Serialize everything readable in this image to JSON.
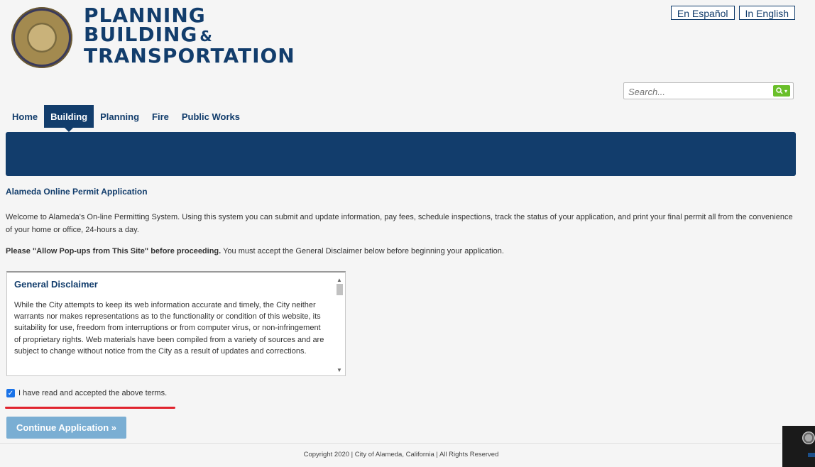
{
  "header": {
    "logo_line1": "Planning",
    "logo_line2": "Building",
    "logo_amp": "&",
    "logo_line3": "Transportation",
    "lang_spanish": "En Español",
    "lang_english": "In English"
  },
  "search": {
    "placeholder": "Search..."
  },
  "nav": {
    "items": [
      "Home",
      "Building",
      "Planning",
      "Fire",
      "Public Works"
    ],
    "active": "Building"
  },
  "main": {
    "title": "Alameda Online Permit Application",
    "welcome": "Welcome to Alameda's On-line Permitting System. Using this system you can submit and update information, pay fees, schedule inspections, track the status of your application, and print your final permit all from the convenience of your home or office, 24-hours a day.",
    "popup_bold": "Please \"Allow Pop-ups from This Site\" before proceeding.",
    "popup_rest": " You must accept the General Disclaimer below before beginning your application."
  },
  "disclaimer": {
    "title": "General Disclaimer",
    "text": "While the City attempts to keep its web information accurate and timely, the City neither warrants nor makes representations as to the functionality or condition of this website, its suitability for use, freedom from interruptions or from computer virus, or non-infringement of proprietary rights. Web materials have been compiled from a variety of sources and are subject to change without notice from the City as a result of updates and corrections."
  },
  "accept": {
    "label": "I have read and accepted the above terms.",
    "checked": true
  },
  "continue_label": "Continue Application »",
  "footer": {
    "copyright": "Copyright 2020 | City of Alameda, California | All Rights Reserved"
  },
  "colors": {
    "primary": "#123d6c",
    "search_button": "#6abf2a",
    "continue_button": "#7aaed3",
    "checkbox": "#1a73e8",
    "underline": "#e0242e"
  },
  "icons": {
    "seal": "city-seal-icon",
    "search": "search-icon",
    "checkbox": "checkmark-icon"
  }
}
